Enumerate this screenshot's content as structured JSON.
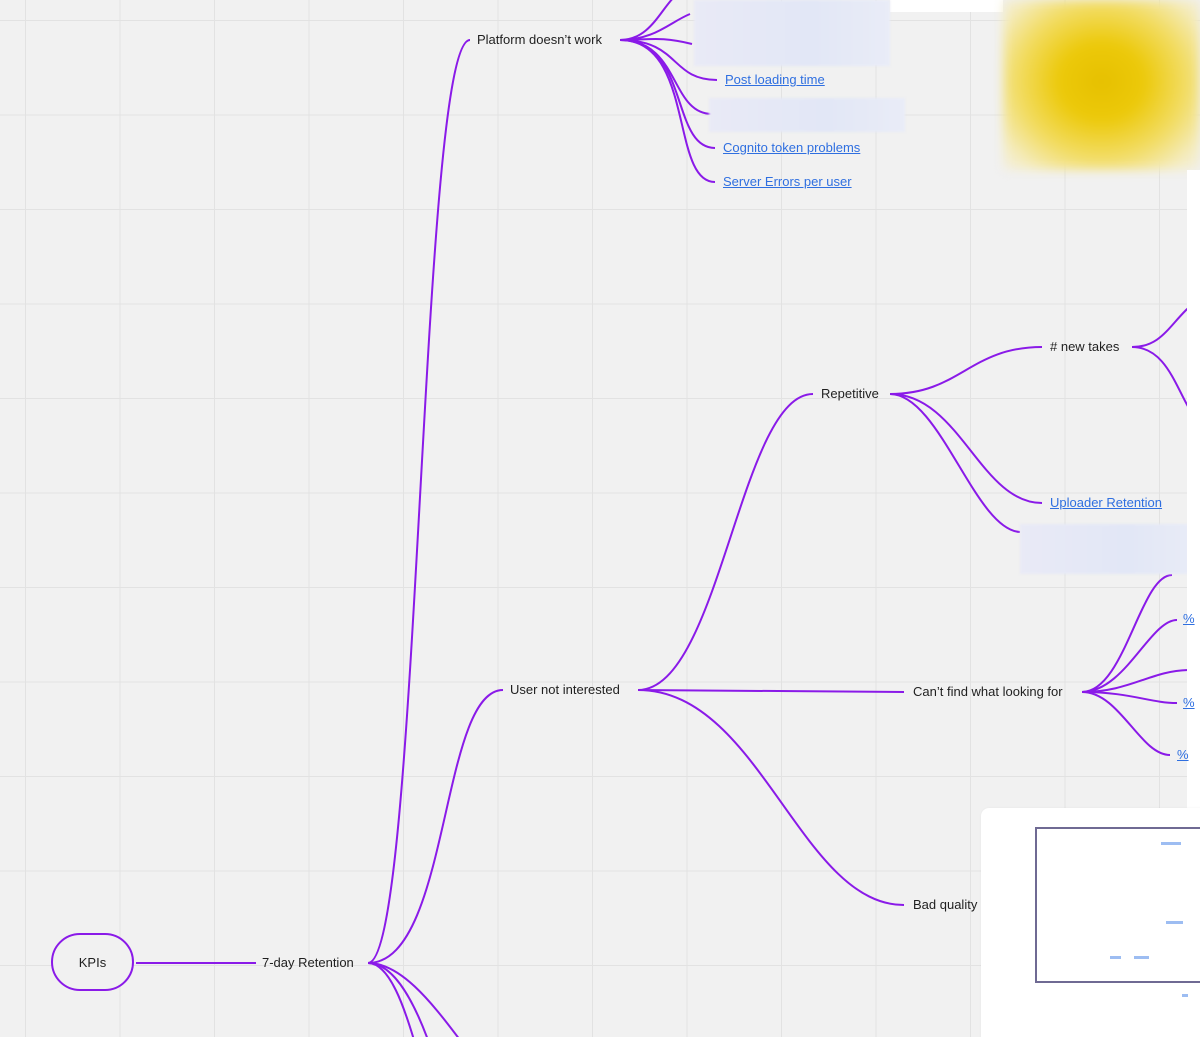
{
  "diagram": {
    "root": "KPIs",
    "retention": "7-day Retention",
    "platform": "Platform doesn’t work",
    "platform_children": [
      "Post loading time",
      "Cognito token problems",
      "Server Errors per user"
    ],
    "user_not_interested": "User not interested",
    "repetitive": "Repetitive",
    "new_takes": "# new takes",
    "uploader_retention": "Uploader Retention",
    "cant_find": "Can’t find what looking for",
    "cant_find_children": [
      "%",
      "%",
      "%"
    ],
    "bad_quality": "Bad quality"
  },
  "colors": {
    "connector": "#8a1ae8",
    "link": "#2f6fe0",
    "background": "#f1f1f1",
    "sticky_note": "#e6c000"
  }
}
